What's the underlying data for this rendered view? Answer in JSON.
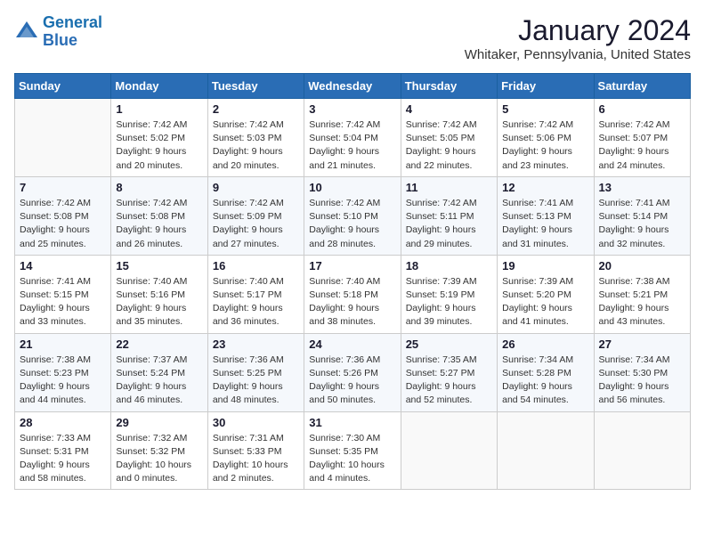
{
  "header": {
    "logo_line1": "General",
    "logo_line2": "Blue",
    "month": "January 2024",
    "location": "Whitaker, Pennsylvania, United States"
  },
  "weekdays": [
    "Sunday",
    "Monday",
    "Tuesday",
    "Wednesday",
    "Thursday",
    "Friday",
    "Saturday"
  ],
  "weeks": [
    [
      {
        "day": "",
        "info": ""
      },
      {
        "day": "1",
        "info": "Sunrise: 7:42 AM\nSunset: 5:02 PM\nDaylight: 9 hours\nand 20 minutes."
      },
      {
        "day": "2",
        "info": "Sunrise: 7:42 AM\nSunset: 5:03 PM\nDaylight: 9 hours\nand 20 minutes."
      },
      {
        "day": "3",
        "info": "Sunrise: 7:42 AM\nSunset: 5:04 PM\nDaylight: 9 hours\nand 21 minutes."
      },
      {
        "day": "4",
        "info": "Sunrise: 7:42 AM\nSunset: 5:05 PM\nDaylight: 9 hours\nand 22 minutes."
      },
      {
        "day": "5",
        "info": "Sunrise: 7:42 AM\nSunset: 5:06 PM\nDaylight: 9 hours\nand 23 minutes."
      },
      {
        "day": "6",
        "info": "Sunrise: 7:42 AM\nSunset: 5:07 PM\nDaylight: 9 hours\nand 24 minutes."
      }
    ],
    [
      {
        "day": "7",
        "info": "Sunrise: 7:42 AM\nSunset: 5:08 PM\nDaylight: 9 hours\nand 25 minutes."
      },
      {
        "day": "8",
        "info": "Sunrise: 7:42 AM\nSunset: 5:08 PM\nDaylight: 9 hours\nand 26 minutes."
      },
      {
        "day": "9",
        "info": "Sunrise: 7:42 AM\nSunset: 5:09 PM\nDaylight: 9 hours\nand 27 minutes."
      },
      {
        "day": "10",
        "info": "Sunrise: 7:42 AM\nSunset: 5:10 PM\nDaylight: 9 hours\nand 28 minutes."
      },
      {
        "day": "11",
        "info": "Sunrise: 7:42 AM\nSunset: 5:11 PM\nDaylight: 9 hours\nand 29 minutes."
      },
      {
        "day": "12",
        "info": "Sunrise: 7:41 AM\nSunset: 5:13 PM\nDaylight: 9 hours\nand 31 minutes."
      },
      {
        "day": "13",
        "info": "Sunrise: 7:41 AM\nSunset: 5:14 PM\nDaylight: 9 hours\nand 32 minutes."
      }
    ],
    [
      {
        "day": "14",
        "info": "Sunrise: 7:41 AM\nSunset: 5:15 PM\nDaylight: 9 hours\nand 33 minutes."
      },
      {
        "day": "15",
        "info": "Sunrise: 7:40 AM\nSunset: 5:16 PM\nDaylight: 9 hours\nand 35 minutes."
      },
      {
        "day": "16",
        "info": "Sunrise: 7:40 AM\nSunset: 5:17 PM\nDaylight: 9 hours\nand 36 minutes."
      },
      {
        "day": "17",
        "info": "Sunrise: 7:40 AM\nSunset: 5:18 PM\nDaylight: 9 hours\nand 38 minutes."
      },
      {
        "day": "18",
        "info": "Sunrise: 7:39 AM\nSunset: 5:19 PM\nDaylight: 9 hours\nand 39 minutes."
      },
      {
        "day": "19",
        "info": "Sunrise: 7:39 AM\nSunset: 5:20 PM\nDaylight: 9 hours\nand 41 minutes."
      },
      {
        "day": "20",
        "info": "Sunrise: 7:38 AM\nSunset: 5:21 PM\nDaylight: 9 hours\nand 43 minutes."
      }
    ],
    [
      {
        "day": "21",
        "info": "Sunrise: 7:38 AM\nSunset: 5:23 PM\nDaylight: 9 hours\nand 44 minutes."
      },
      {
        "day": "22",
        "info": "Sunrise: 7:37 AM\nSunset: 5:24 PM\nDaylight: 9 hours\nand 46 minutes."
      },
      {
        "day": "23",
        "info": "Sunrise: 7:36 AM\nSunset: 5:25 PM\nDaylight: 9 hours\nand 48 minutes."
      },
      {
        "day": "24",
        "info": "Sunrise: 7:36 AM\nSunset: 5:26 PM\nDaylight: 9 hours\nand 50 minutes."
      },
      {
        "day": "25",
        "info": "Sunrise: 7:35 AM\nSunset: 5:27 PM\nDaylight: 9 hours\nand 52 minutes."
      },
      {
        "day": "26",
        "info": "Sunrise: 7:34 AM\nSunset: 5:28 PM\nDaylight: 9 hours\nand 54 minutes."
      },
      {
        "day": "27",
        "info": "Sunrise: 7:34 AM\nSunset: 5:30 PM\nDaylight: 9 hours\nand 56 minutes."
      }
    ],
    [
      {
        "day": "28",
        "info": "Sunrise: 7:33 AM\nSunset: 5:31 PM\nDaylight: 9 hours\nand 58 minutes."
      },
      {
        "day": "29",
        "info": "Sunrise: 7:32 AM\nSunset: 5:32 PM\nDaylight: 10 hours\nand 0 minutes."
      },
      {
        "day": "30",
        "info": "Sunrise: 7:31 AM\nSunset: 5:33 PM\nDaylight: 10 hours\nand 2 minutes."
      },
      {
        "day": "31",
        "info": "Sunrise: 7:30 AM\nSunset: 5:35 PM\nDaylight: 10 hours\nand 4 minutes."
      },
      {
        "day": "",
        "info": ""
      },
      {
        "day": "",
        "info": ""
      },
      {
        "day": "",
        "info": ""
      }
    ]
  ]
}
